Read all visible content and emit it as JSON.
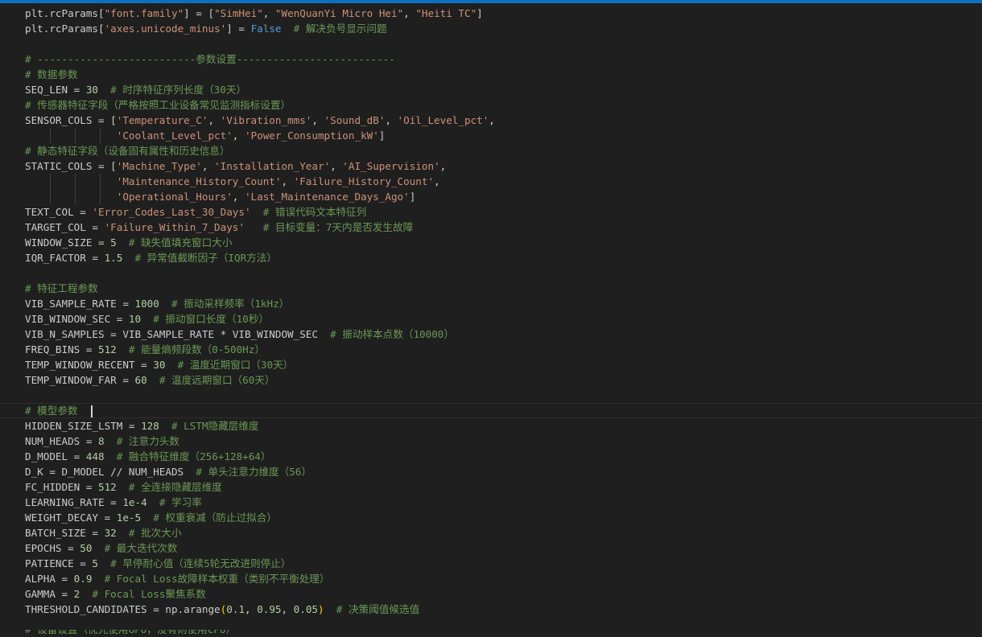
{
  "editor": {
    "lines": [
      [
        "plt.rcParams[",
        "\"font.family\"",
        "] = [",
        "\"SimHei\"",
        ", ",
        "\"WenQuanYi Micro Hei\"",
        ", ",
        "\"Heiti TC\"",
        "]"
      ],
      [
        "plt.rcParams[",
        "'axes.unicode_minus'",
        "] = ",
        "False",
        "  ",
        "# 解决负号显示问题"
      ],
      [],
      [
        "# --------------------------参数设置--------------------------"
      ],
      [
        "# 数据参数"
      ],
      [
        "SEQ_LEN = ",
        "30",
        "  ",
        "# 时序特征序列长度（30天）"
      ],
      [
        "# 传感器特征字段（严格按照工业设备常见监测指标设置）"
      ],
      [
        "SENSOR_COLS = [",
        "'Temperature_C'",
        ", ",
        "'Vibration_mms'",
        ", ",
        "'Sound_dB'",
        ", ",
        "'Oil_Level_pct'",
        ","
      ],
      [
        "               ",
        "'Coolant_Level_pct'",
        ", ",
        "'Power_Consumption_kW'",
        "]"
      ],
      [
        "# 静态特征字段（设备固有属性和历史信息）"
      ],
      [
        "STATIC_COLS = [",
        "'Machine_Type'",
        ", ",
        "'Installation_Year'",
        ", ",
        "'AI_Supervision'",
        ","
      ],
      [
        "               ",
        "'Maintenance_History_Count'",
        ", ",
        "'Failure_History_Count'",
        ","
      ],
      [
        "               ",
        "'Operational_Hours'",
        ", ",
        "'Last_Maintenance_Days_Ago'",
        "]"
      ],
      [
        "TEXT_COL = ",
        "'Error_Codes_Last_30_Days'",
        "  ",
        "# 错误代码文本特征列"
      ],
      [
        "TARGET_COL = ",
        "'Failure_Within_7_Days'",
        "   ",
        "# 目标变量：7天内是否发生故障"
      ],
      [
        "WINDOW_SIZE = ",
        "5",
        "  ",
        "# 缺失值填充窗口大小"
      ],
      [
        "IQR_FACTOR = ",
        "1.5",
        "  ",
        "# 异常值截断因子（IQR方法）"
      ],
      [],
      [
        "# 特征工程参数"
      ],
      [
        "VIB_SAMPLE_RATE = ",
        "1000",
        "  ",
        "# 振动采样频率（1kHz）"
      ],
      [
        "VIB_WINDOW_SEC = ",
        "10",
        "  ",
        "# 振动窗口长度（10秒）"
      ],
      [
        "VIB_N_SAMPLES = VIB_SAMPLE_RATE * VIB_WINDOW_SEC",
        "  ",
        "# 振动样本点数（10000）"
      ],
      [
        "FREQ_BINS = ",
        "512",
        "  ",
        "# 能量熵频段数（0-500Hz）"
      ],
      [
        "TEMP_WINDOW_RECENT = ",
        "30",
        "  ",
        "# 温度近期窗口（30天）"
      ],
      [
        "TEMP_WINDOW_FAR = ",
        "60",
        "  ",
        "# 温度远期窗口（60天）"
      ],
      [],
      [
        "# 模型参数  "
      ],
      [
        "HIDDEN_SIZE_LSTM = ",
        "128",
        "  ",
        "# LSTM隐藏层维度"
      ],
      [
        "NUM_HEADS = ",
        "8",
        "  ",
        "# 注意力头数"
      ],
      [
        "D_MODEL = ",
        "448",
        "  ",
        "# 融合特征维度（256+128+64）"
      ],
      [
        "D_K = D_MODEL // NUM_HEADS",
        "  ",
        "# 单头注意力维度（56）"
      ],
      [
        "FC_HIDDEN = ",
        "512",
        "  ",
        "# 全连接隐藏层维度"
      ],
      [
        "LEARNING_RATE = ",
        "1e-4",
        "  ",
        "# 学习率"
      ],
      [
        "WEIGHT_DECAY = ",
        "1e-5",
        "  ",
        "# 权重衰减（防止过拟合）"
      ],
      [
        "BATCH_SIZE = ",
        "32",
        "  ",
        "# 批次大小"
      ],
      [
        "EPOCHS = ",
        "50",
        "  ",
        "# 最大迭代次数"
      ],
      [
        "PATIENCE = ",
        "5",
        "  ",
        "# 早停耐心值（连续5轮无改进则停止）"
      ],
      [
        "ALPHA = ",
        "0.9",
        "  ",
        "# Focal Loss故障样本权重（类别不平衡处理）"
      ],
      [
        "GAMMA = ",
        "2",
        "  ",
        "# Focal Loss聚焦系数"
      ],
      [
        "THRESHOLD_CANDIDATES = np.arange",
        "(",
        "0.1",
        ", ",
        "0.95",
        ", ",
        "0.05",
        ")",
        "  ",
        "# 决策阈值候选值"
      ],
      []
    ],
    "cut_line": [
      "# 设备设置（优先使用GPU，没有则使用CPU）"
    ]
  }
}
